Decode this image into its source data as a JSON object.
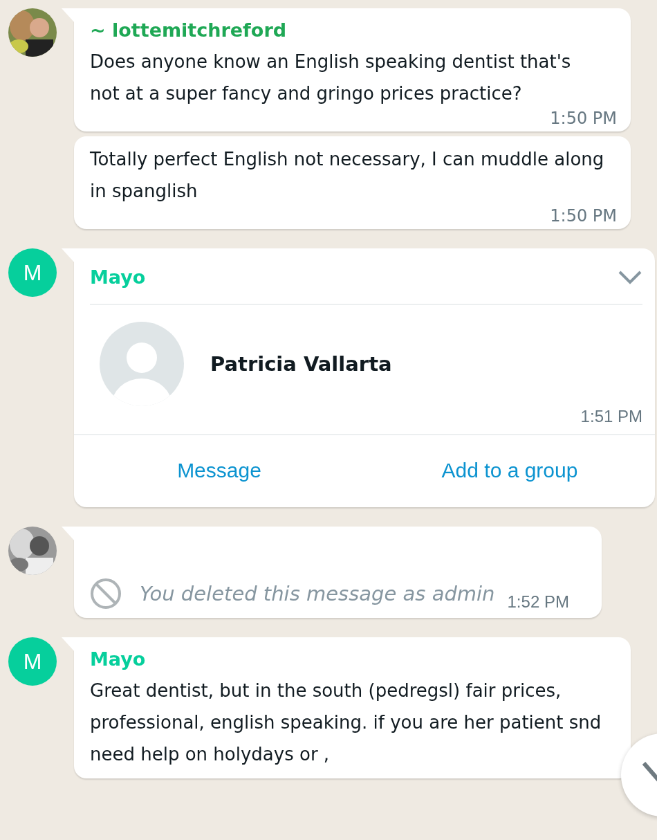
{
  "messages": [
    {
      "kind": "text",
      "sender": "~ lottemitchreford",
      "color": "#1fa855",
      "text": "Does anyone know an English speaking dentist that's not at a super fancy and gringo prices practice?",
      "time": "1:50 PM"
    },
    {
      "kind": "text",
      "text": "Totally perfect English not necessary, I can muddle along in spanglish",
      "time": "1:50 PM"
    },
    {
      "kind": "contact",
      "avatar": {
        "kind": "letter",
        "letter": "M",
        "color": "#06cf9c"
      },
      "sender": "Mayo",
      "color": "#06cf9c",
      "contact_name": "Patricia Vallarta",
      "time": "1:51 PM",
      "actions": [
        "Message",
        "Add to a group"
      ]
    },
    {
      "kind": "deleted",
      "text": "You deleted this message as admin",
      "time": "1:52 PM"
    },
    {
      "kind": "text",
      "avatar": {
        "kind": "letter",
        "letter": "M",
        "color": "#06cf9c"
      },
      "sender": "Mayo",
      "color": "#06cf9c",
      "text": "Great dentist, but in the south (pedregsl) fair prices, professional, english speaking. if you are her patient snd need help on holydays or ,"
    }
  ]
}
